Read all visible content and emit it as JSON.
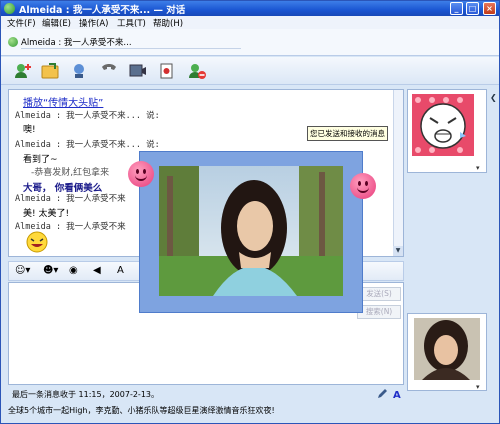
{
  "window": {
    "title": "Almeida : 我一人承受不来... — 对话",
    "buttons": {
      "minimize": "_",
      "maximize": "□",
      "close": "×"
    }
  },
  "menu": [
    "文件(F)",
    "编辑(E)",
    "操作(A)",
    "工具(T)",
    "帮助(H)"
  ],
  "contact": {
    "name_line": "Almeida : 我一人承受不来..."
  },
  "toolbar": [
    "add-contact-icon",
    "send-file-icon",
    "voice-call-icon",
    "phone-icon",
    "video-icon",
    "game-icon",
    "block-icon"
  ],
  "conversation": {
    "link": "播放“传情大头贴”",
    "messages": [
      {
        "header": "Almeida : 我一人承受不来... 说:",
        "text": "噢!"
      },
      {
        "header": "Almeida : 我一人承受不来... 说:",
        "text": "看到了~"
      },
      {
        "header": "",
        "text": "-恭喜发财,红包拿来"
      },
      {
        "header": "",
        "text": "大哥，   你看俩美么"
      },
      {
        "header": "Almeida : 我一人承受不来",
        "text": "美! 太美了!"
      },
      {
        "header": "Almeida : 我一人承受不来",
        "text": ""
      }
    ],
    "emoticon": "laughing-face-icon"
  },
  "tooltip": "您已发送和接收的消息",
  "input": {
    "send_label": "发送(S)",
    "search_label": "搜索(N)"
  },
  "status": {
    "last_message": "最后一条消息收于 11:15，2007-2-13。"
  },
  "ad": "全球5个城市一起High，李克勤、小猪乐队等超级巨星演绎激情音乐狂欢夜!",
  "colors": {
    "title_bar": "#1b56d2",
    "frame": "#d8e6f6",
    "link": "#1f2ec8",
    "photo_frame": "#7ea3e0",
    "smiley": "#e83a7a"
  }
}
